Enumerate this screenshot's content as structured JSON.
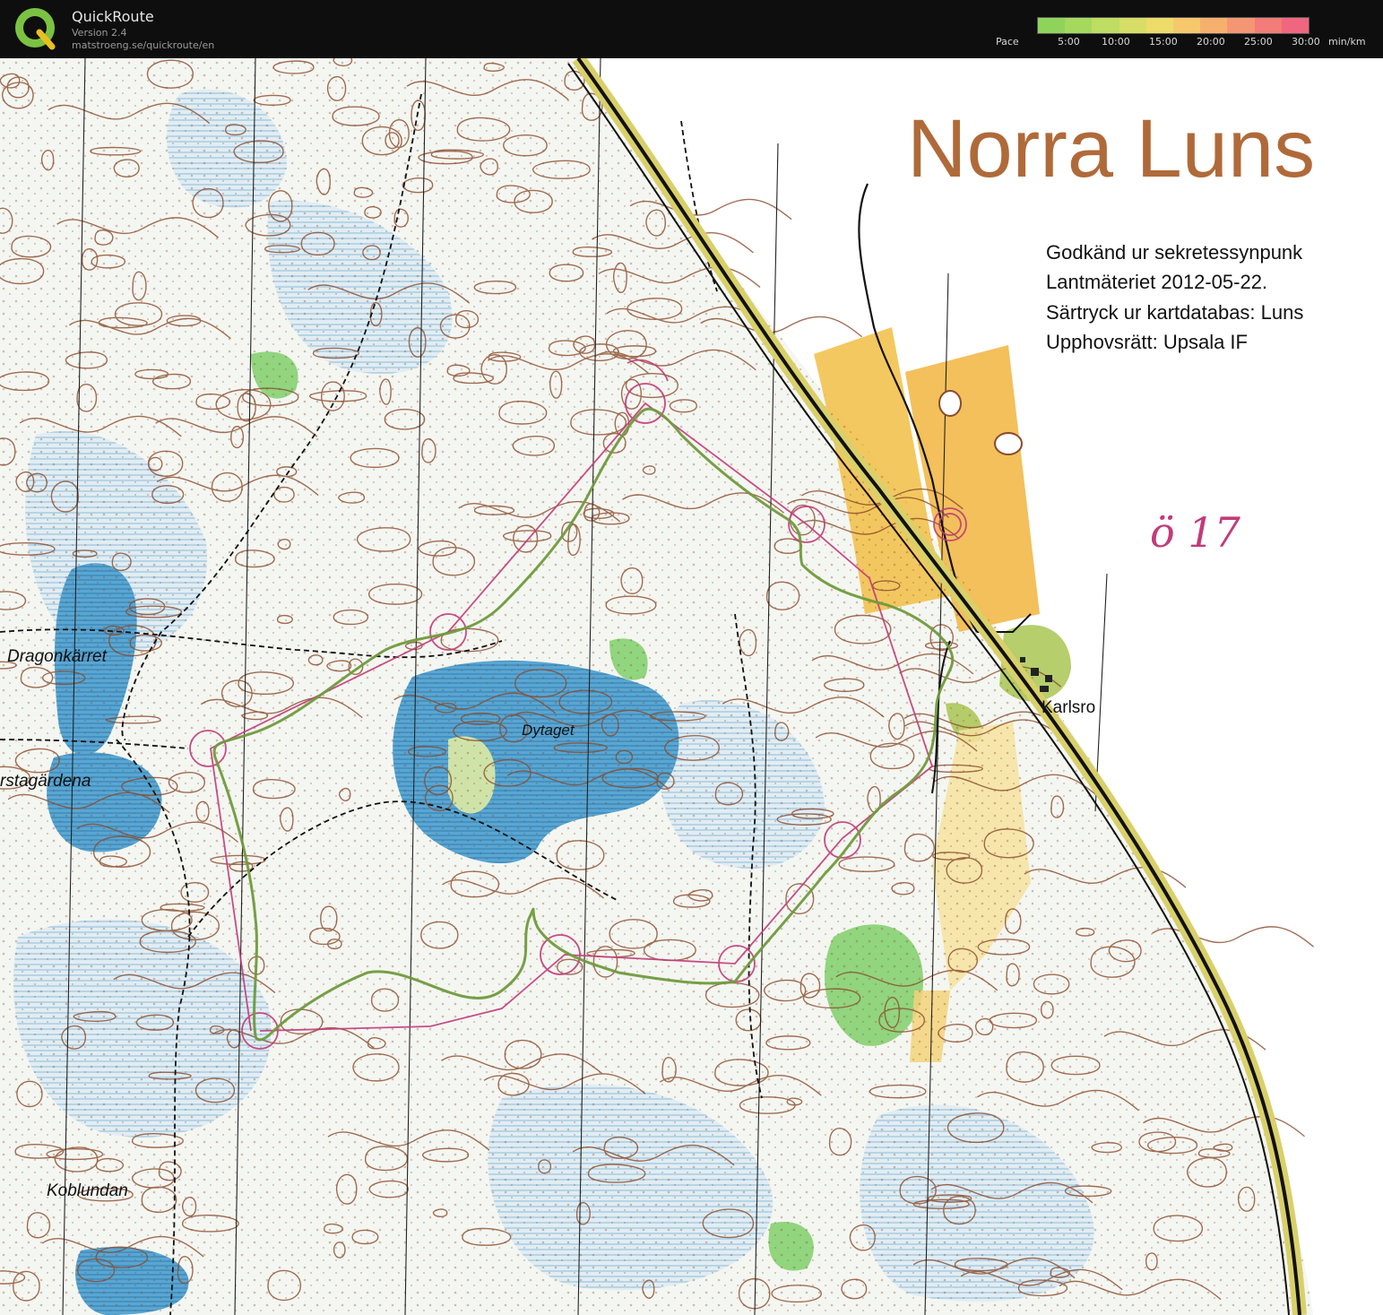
{
  "header": {
    "app_name": "QuickRoute",
    "version": "Version 2.4",
    "url": "matstroeng.se/quickroute/en",
    "logo_letter": "Q",
    "logo_icon": "quickroute-logo-icon",
    "pace_label": "Pace",
    "pace_ticks": [
      "5:00",
      "10:00",
      "15:00",
      "20:00",
      "25:00",
      "30:00"
    ],
    "pace_unit": "min/km",
    "pace_colors": [
      "#8fd45a",
      "#a4d95e",
      "#bedd62",
      "#d7dd66",
      "#eddb6a",
      "#f6c86c",
      "#f6b06e",
      "#f49673",
      "#f27c78",
      "#f0667e"
    ]
  },
  "map": {
    "title": "Norra Luns",
    "approval_lines": [
      "Godkänd ur sekretessynpunk",
      "Lantmäteriet 2012-05-22.",
      "Särtryck ur kartdatabas: Luns",
      "Upphovsrätt: Upsala IF"
    ],
    "place_names": {
      "dragonkarret": "Dragonkärret",
      "dytaget": "Dytaget",
      "karlsro": "Karlsro",
      "koblundan": "Koblundan",
      "gardena": "rstagärdena"
    },
    "handwritten_note": "ö 17",
    "colors": {
      "paper": "#f7f8f4",
      "contour": "#8a4a2a",
      "water": "#4f9cc8",
      "marsh": "#9dc7e0",
      "green": "#7fcf6a",
      "open_land": "#f3c24f",
      "route": "#7c9a4a",
      "course": "#c23b7a",
      "title": "#b06a3a"
    }
  }
}
